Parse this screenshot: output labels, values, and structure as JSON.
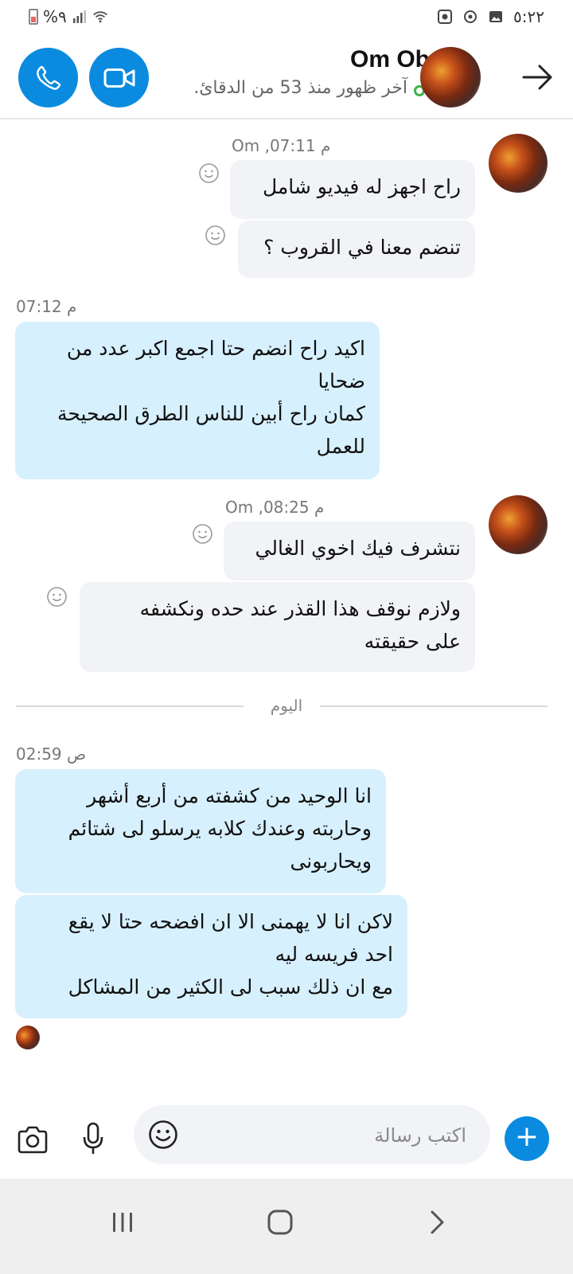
{
  "status_bar": {
    "left_text": "%٩",
    "time": "٥:٢٢"
  },
  "header": {
    "contact_name": "Om Ob",
    "last_seen": "آخر ظهور منذ 53 من الدقائ."
  },
  "messages": [
    {
      "id": "m1",
      "direction": "incoming",
      "timestamp": "Om ,07:11 م",
      "text": "راح اجهز له فيديو شامل"
    },
    {
      "id": "m2",
      "direction": "incoming",
      "text": "تنضم معنا في القروب ؟"
    },
    {
      "id": "m3",
      "direction": "outgoing",
      "timestamp": "07:12 م",
      "text": "اكيد راح انضم حتا اجمع اكبر عدد من\nضحايا\nكمان راح أبين للناس الطرق الصحيحة\nللعمل"
    },
    {
      "id": "m4",
      "direction": "incoming",
      "timestamp": "Om ,08:25 م",
      "text": "نتشرف فيك اخوي الغالي"
    },
    {
      "id": "m5",
      "direction": "incoming",
      "text": "ولازم نوقف هذا القذر عند حده ونكشفه\nعلى حقيقته"
    },
    {
      "id": "m6",
      "direction": "outgoing",
      "timestamp": "02:59 ص",
      "text": "انا الوحيد من كشفته من أربع أشهر\nوحاربته وعندك كلابه يرسلو لى شتائم\nويحاربونى"
    },
    {
      "id": "m7",
      "direction": "outgoing",
      "text": "لاكن انا لا يهمنى الا ان افضحه حتا لا يقع\nاحد فريسه ليه\nمع ان ذلك سبب لى الكثير من المشاكل"
    }
  ],
  "day_divider": "اليوم",
  "composer": {
    "placeholder": "اكتب رسالة",
    "plus_label": "+"
  },
  "colors": {
    "accent": "#0a8be0",
    "incoming_bubble": "#f1f3f6",
    "outgoing_bubble": "#d7f0fd",
    "online": "#3bb54a"
  }
}
